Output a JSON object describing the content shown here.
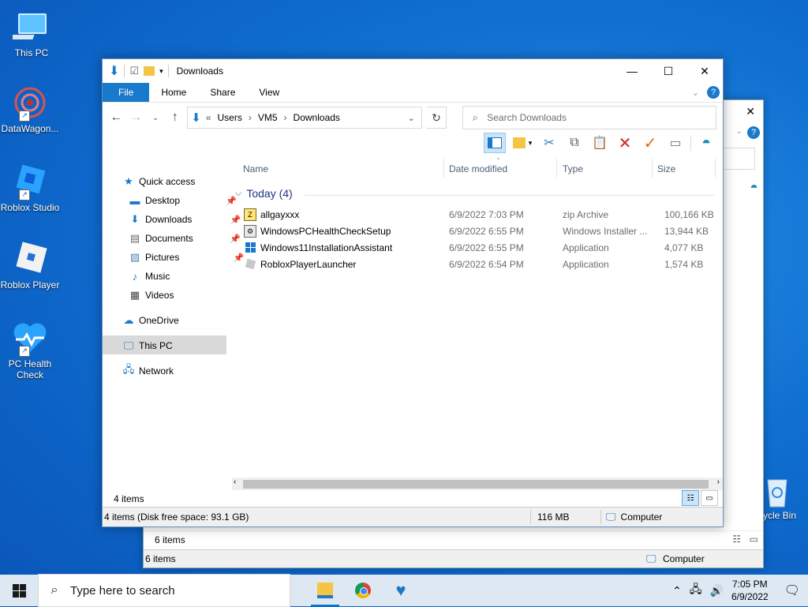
{
  "desktop": {
    "icons": [
      {
        "label": "This PC"
      },
      {
        "label": "DataWagon..."
      },
      {
        "label": "Roblox Studio"
      },
      {
        "label": "Roblox Player"
      },
      {
        "label": "PC Health Check"
      },
      {
        "label": "ycle Bin"
      }
    ]
  },
  "back_window": {
    "status_items": "6 items",
    "status_items2": "6 items",
    "status_location": "Computer"
  },
  "window": {
    "title": "Downloads",
    "tabs": {
      "file": "File",
      "home": "Home",
      "share": "Share",
      "view": "View"
    },
    "address": {
      "prefix": "«",
      "crumbs": [
        "Users",
        "VM5",
        "Downloads"
      ]
    },
    "search_placeholder": "Search Downloads",
    "nav": {
      "quick_access": "Quick access",
      "desktop": "Desktop",
      "downloads": "Downloads",
      "documents": "Documents",
      "pictures": "Pictures",
      "music": "Music",
      "videos": "Videos",
      "onedrive": "OneDrive",
      "this_pc": "This PC",
      "network": "Network"
    },
    "columns": {
      "name": "Name",
      "date": "Date modified",
      "type": "Type",
      "size": "Size"
    },
    "group_label": "Today (4)",
    "files": [
      {
        "name": "allgayxxx",
        "date": "6/9/2022 7:03 PM",
        "type": "zip Archive",
        "size": "100,166 KB"
      },
      {
        "name": "WindowsPCHealthCheckSetup",
        "date": "6/9/2022 6:55 PM",
        "type": "Windows Installer ...",
        "size": "13,944 KB"
      },
      {
        "name": "Windows11InstallationAssistant",
        "date": "6/9/2022 6:55 PM",
        "type": "Application",
        "size": "4,077 KB"
      },
      {
        "name": "RobloxPlayerLauncher",
        "date": "6/9/2022 6:54 PM",
        "type": "Application",
        "size": "1,574 KB"
      }
    ],
    "item_count": "4 items",
    "status": {
      "disk": "4 items (Disk free space: 93.1 GB)",
      "size": "116 MB",
      "location": "Computer"
    }
  },
  "taskbar": {
    "search_placeholder": "Type here to search",
    "time": "7:05 PM",
    "date": "6/9/2022"
  },
  "colors": {
    "accent": "#1979ca",
    "taskbar": "#dde8f3",
    "selection": "#cce4f7"
  }
}
